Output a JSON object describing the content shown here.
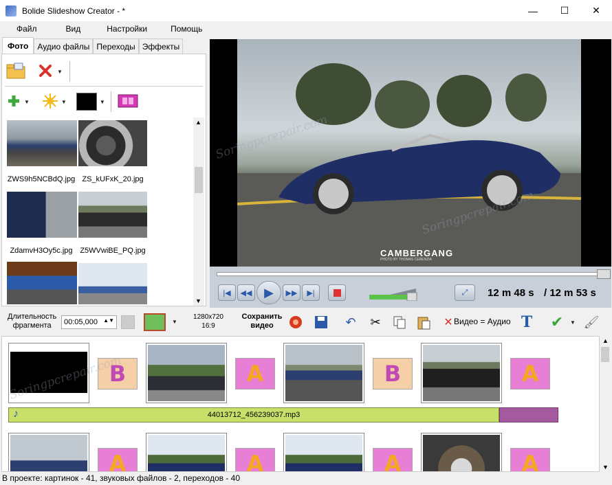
{
  "window": {
    "title": "Bolide Slideshow Creator - *",
    "min": "—",
    "max": "☐",
    "close": "✕"
  },
  "menu": [
    "Файл",
    "Вид",
    "Настройки",
    "Помощь"
  ],
  "tabs": [
    "Фото",
    "Аудио файлы",
    "Переходы",
    "Эффекты"
  ],
  "thumbs": [
    {
      "label": "ZWS9h5NCBdQ.jpg"
    },
    {
      "label": "ZS_kUFxK_20.jpg"
    },
    {
      "label": "ZdamvH3Oy5c.jpg"
    },
    {
      "label": "Z5WVwiBE_PQ.jpg"
    }
  ],
  "preview": {
    "brand": "CAMBERGANG",
    "brand_sub": "PHOTO BY THOMAS CERENZIA"
  },
  "player": {
    "current": "12 m 48 s",
    "total": "/ 12 m 53 s"
  },
  "toolbar": {
    "fragment_label_1": "Длительность",
    "fragment_label_2": "фрагмента",
    "duration": "00:05,000",
    "resolution_1": "1280x720",
    "resolution_2": "16:9",
    "save_1": "Сохранить",
    "save_2": "видео",
    "video_audio": "Видео = Аудио"
  },
  "timeline": {
    "audio_file": "44013712_456239037.mp3",
    "transitions": [
      "B",
      "A",
      "B",
      "A"
    ],
    "transitions_row2": [
      "A",
      "A",
      "A",
      "A"
    ]
  },
  "status": "В проекте: картинок - 41, звуковых файлов - 2, переходов - 40",
  "watermark": "Soringpcrepair.com",
  "colors": {
    "accent": "#2a5aa8",
    "audio": "#c8e06a",
    "audio_end": "#a45a9e",
    "player_bar": "#c8cfd8"
  }
}
